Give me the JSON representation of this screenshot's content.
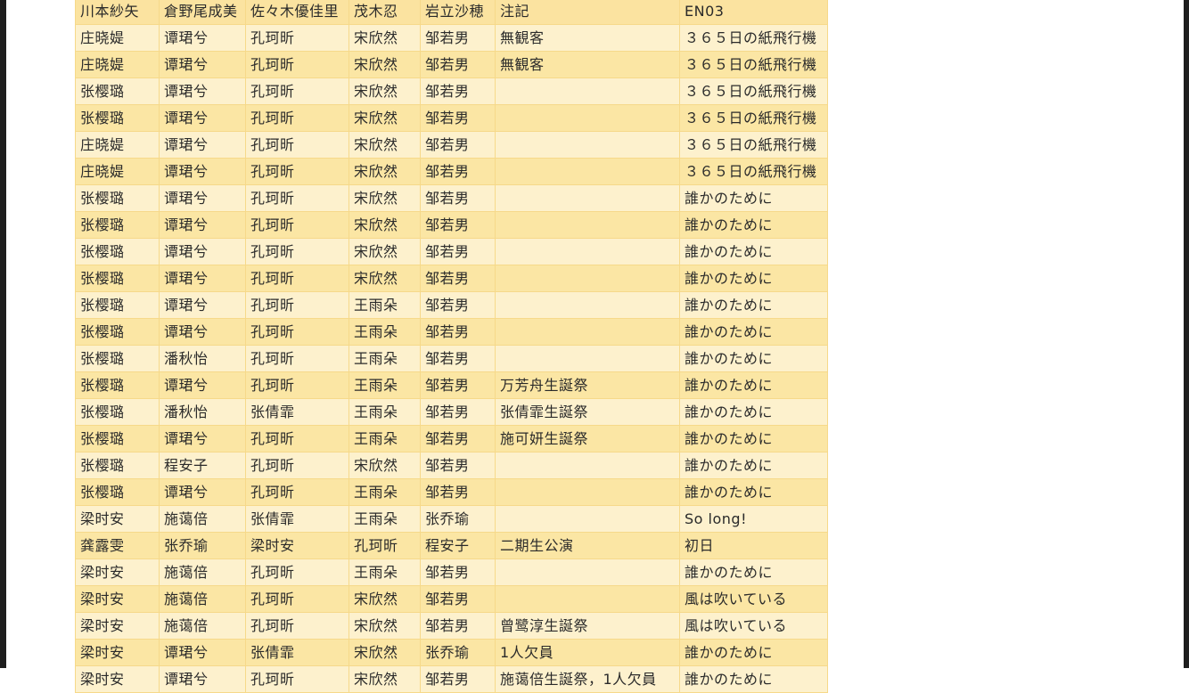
{
  "columns": [
    "川本紗矢",
    "倉野尾成美",
    "佐々木優佳里",
    "茂木忍",
    "岩立沙穂",
    "注記",
    "EN03"
  ],
  "rows": [
    [
      "庄晓媞",
      "谭珺兮",
      "孔珂昕",
      "宋欣然",
      "邹若男",
      "無観客",
      "３６５日の紙飛行機"
    ],
    [
      "庄晓媞",
      "谭珺兮",
      "孔珂昕",
      "宋欣然",
      "邹若男",
      "無観客",
      "３６５日の紙飛行機"
    ],
    [
      "张樱璐",
      "谭珺兮",
      "孔珂昕",
      "宋欣然",
      "邹若男",
      "",
      "３６５日の紙飛行機"
    ],
    [
      "张樱璐",
      "谭珺兮",
      "孔珂昕",
      "宋欣然",
      "邹若男",
      "",
      "３６５日の紙飛行機"
    ],
    [
      "庄晓媞",
      "谭珺兮",
      "孔珂昕",
      "宋欣然",
      "邹若男",
      "",
      "３６５日の紙飛行機"
    ],
    [
      "庄晓媞",
      "谭珺兮",
      "孔珂昕",
      "宋欣然",
      "邹若男",
      "",
      "３６５日の紙飛行機"
    ],
    [
      "张樱璐",
      "谭珺兮",
      "孔珂昕",
      "宋欣然",
      "邹若男",
      "",
      "誰かのために"
    ],
    [
      "张樱璐",
      "谭珺兮",
      "孔珂昕",
      "宋欣然",
      "邹若男",
      "",
      "誰かのために"
    ],
    [
      "张樱璐",
      "谭珺兮",
      "孔珂昕",
      "宋欣然",
      "邹若男",
      "",
      "誰かのために"
    ],
    [
      "张樱璐",
      "谭珺兮",
      "孔珂昕",
      "宋欣然",
      "邹若男",
      "",
      "誰かのために"
    ],
    [
      "张樱璐",
      "谭珺兮",
      "孔珂昕",
      "王雨朵",
      "邹若男",
      "",
      "誰かのために"
    ],
    [
      "张樱璐",
      "谭珺兮",
      "孔珂昕",
      "王雨朵",
      "邹若男",
      "",
      "誰かのために"
    ],
    [
      "张樱璐",
      "潘秋怡",
      "孔珂昕",
      "王雨朵",
      "邹若男",
      "",
      "誰かのために"
    ],
    [
      "张樱璐",
      "谭珺兮",
      "孔珂昕",
      "王雨朵",
      "邹若男",
      "万芳舟生誕祭",
      "誰かのために"
    ],
    [
      "张樱璐",
      "潘秋怡",
      "张倩霏",
      "王雨朵",
      "邹若男",
      "张倩霏生誕祭",
      "誰かのために"
    ],
    [
      "张樱璐",
      "谭珺兮",
      "孔珂昕",
      "王雨朵",
      "邹若男",
      "施可妍生誕祭",
      "誰かのために"
    ],
    [
      "张樱璐",
      "程安子",
      "孔珂昕",
      "宋欣然",
      "邹若男",
      "",
      "誰かのために"
    ],
    [
      "张樱璐",
      "谭珺兮",
      "孔珂昕",
      "王雨朵",
      "邹若男",
      "",
      "誰かのために"
    ],
    [
      "梁时安",
      "施蔼倍",
      "张倩霏",
      "王雨朵",
      "张乔瑜",
      "",
      "So long!"
    ],
    [
      "龚露雯",
      "张乔瑜",
      "梁时安",
      "孔珂昕",
      "程安子",
      "二期生公演",
      "初日"
    ],
    [
      "梁时安",
      "施蔼倍",
      "孔珂昕",
      "王雨朵",
      "邹若男",
      "",
      "誰かのために"
    ],
    [
      "梁时安",
      "施蔼倍",
      "孔珂昕",
      "宋欣然",
      "邹若男",
      "",
      "風は吹いている"
    ],
    [
      "梁时安",
      "施蔼倍",
      "孔珂昕",
      "宋欣然",
      "邹若男",
      "曾鹭淳生誕祭",
      "風は吹いている"
    ],
    [
      "梁时安",
      "谭珺兮",
      "张倩霏",
      "宋欣然",
      "张乔瑜",
      "1人欠員",
      "誰かのために"
    ],
    [
      "梁时安",
      "谭珺兮",
      "孔珂昕",
      "宋欣然",
      "邹若男",
      "施蔼倍生誕祭，1人欠員",
      "誰かのために"
    ]
  ],
  "colors": {
    "row_dark": "#fbe6a4",
    "row_light": "#fdf1cd",
    "border": "#f6d98a",
    "frame": "#1e1e1e"
  }
}
